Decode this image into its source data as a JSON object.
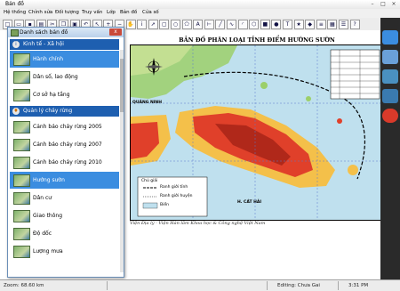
{
  "window": {
    "title": "Bản đồ"
  },
  "menu": [
    "Hệ thống",
    "Chỉnh sửa",
    "Đối tượng",
    "Truy vấn",
    "Lớp",
    "Bản đồ",
    "Cửa số"
  ],
  "toolbar_icons": [
    "new-icon",
    "open-icon",
    "save-icon",
    "print-icon",
    "cut-icon",
    "copy-icon",
    "paste-icon",
    "undo-icon",
    "arrow-icon",
    "zoom-in-icon",
    "zoom-out-icon",
    "pan-icon",
    "info-icon",
    "select-icon",
    "select-rect-icon",
    "select-circle-icon",
    "select-poly-icon",
    "label-icon",
    "ruler-icon",
    "line-icon",
    "polyline-icon",
    "arc-icon",
    "polygon-icon",
    "rectangle-icon",
    "ellipse-icon",
    "text-icon",
    "symbol-icon",
    "node-icon",
    "layer-icon",
    "map-icon",
    "legend-icon",
    "help-icon"
  ],
  "panel": {
    "title": "Danh sách bản đồ",
    "close_label": "x",
    "categories": [
      {
        "label": "Kinh tế - Xã hội",
        "icon": "info-icon"
      },
      {
        "label": "Quản lý cháy rừng",
        "icon": "fire-icon"
      }
    ],
    "group1": [
      "Hành chính",
      "Dân số, lao động",
      "Cơ sở hạ tầng"
    ],
    "group2": [
      "Cảnh báo cháy rừng 2005",
      "Cảnh báo cháy rừng 2007",
      "Cảnh báo cháy rừng 2010",
      "Hướng sườn",
      "Dân cư",
      "Giao thông",
      "Độ dốc",
      "Lượng mưa"
    ],
    "selected_group1": "Hành chính",
    "selected_group2": "Hướng sườn"
  },
  "map": {
    "title": "BẢN ĐỒ PHÂN LOẠI TỈNH ĐIỂM HƯỚNG SƯỜN",
    "labels": {
      "quang_ninh": "QUẢNG NINH",
      "cat_hai": "H. CÁT HẢI"
    },
    "legend": {
      "title": "Chú giải",
      "items": [
        "Ranh giới tỉnh",
        "Ranh giới huyện",
        "Biển"
      ]
    },
    "credit": "Viện Địa lý - Viện Hàn lâm Khoa học & Công nghệ Việt Nam",
    "colors": {
      "sea": "#bfe0ee",
      "land_low": "#9ccf6a",
      "land_mid": "#f4c04a",
      "land_high": "#e0402a"
    }
  },
  "right_bar_icons": [
    "tools-icon",
    "layers-icon",
    "globe-icon",
    "map-icon",
    "power-icon"
  ],
  "status": {
    "zoom": "Zoom: 68.60 km",
    "editing": "Editing: Chưa Gai",
    "time": "3:31 PM"
  }
}
